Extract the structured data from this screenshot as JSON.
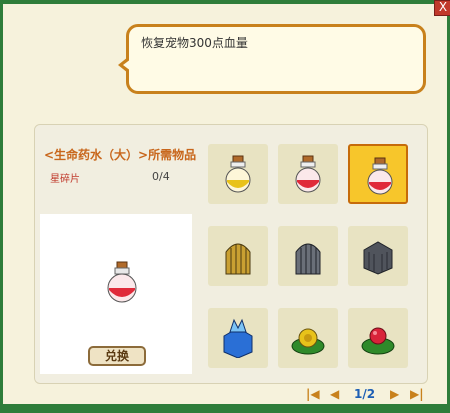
{
  "window": {
    "close_label": "X"
  },
  "tooltip": {
    "text": "恢复宠物300点血量"
  },
  "recipe": {
    "title": "<生命药水（大）>所需物品",
    "material_name": "星碎片",
    "material_count": "0/4"
  },
  "exchange_button": {
    "label": "兑换"
  },
  "slots": [
    {
      "name": "potion-yellow-icon",
      "selected": false
    },
    {
      "name": "potion-red-small-icon",
      "selected": false
    },
    {
      "name": "potion-red-large-icon",
      "selected": true
    },
    {
      "name": "cage-golden-icon",
      "selected": false
    },
    {
      "name": "cage-dark-icon",
      "selected": false
    },
    {
      "name": "crate-dark-icon",
      "selected": false
    },
    {
      "name": "crystal-blue-icon",
      "selected": false
    },
    {
      "name": "plant-yellow-icon",
      "selected": false
    },
    {
      "name": "plant-red-icon",
      "selected": false
    }
  ],
  "pagination": {
    "page": "1/2"
  },
  "colors": {
    "accent": "#c8811c",
    "frame": "#2e7d3a",
    "selected": "#f7c62b"
  }
}
